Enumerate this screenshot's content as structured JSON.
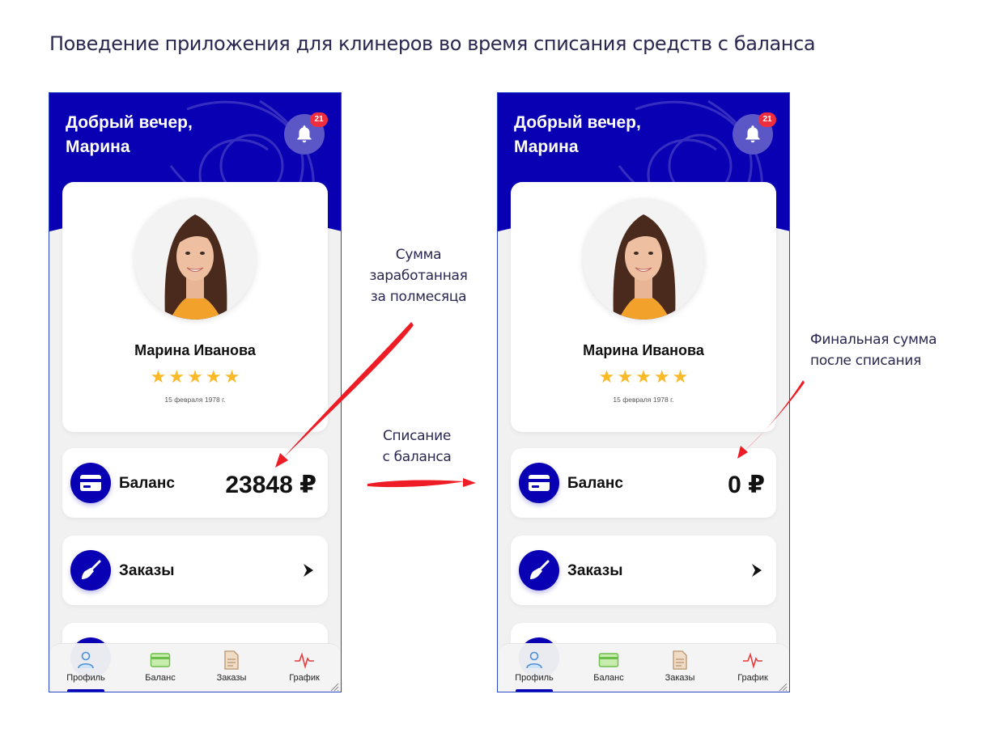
{
  "page": {
    "title": "Поведение приложения для клинеров во время списания средств с баланса"
  },
  "annotations": {
    "earned_line1": "Сумма",
    "earned_line2": "заработанная",
    "earned_line3": "за полмесяца",
    "writeoff_line1": "Списание",
    "writeoff_line2": "с баланса",
    "final_line1": "Финальная сумма",
    "final_line2": "после списания",
    "arrow_color": "#ee1c25"
  },
  "screens": [
    {
      "greeting_line1": "Добрый вечер,",
      "greeting_line2": "Марина",
      "notification_count": "21",
      "profile_name": "Марина Иванова",
      "rating_stars": 5,
      "dob": "15 февраля 1978 г.",
      "balance_label": "Баланс",
      "balance_amount": "23848 ₽",
      "orders_label": "Заказы",
      "tabs": [
        "Профиль",
        "Баланс",
        "Заказы",
        "График"
      ],
      "active_tab": "Профиль"
    },
    {
      "greeting_line1": "Добрый вечер,",
      "greeting_line2": "Марина",
      "notification_count": "21",
      "profile_name": "Марина Иванова",
      "rating_stars": 5,
      "dob": "15 февраля 1978 г.",
      "balance_label": "Баланс",
      "balance_amount": "0 ₽",
      "orders_label": "Заказы",
      "tabs": [
        "Профиль",
        "Баланс",
        "Заказы",
        "График"
      ],
      "active_tab": "Профиль"
    }
  ],
  "colors": {
    "brand": "#0a00b3",
    "badge": "#ee2d3e",
    "star": "#f9b928"
  },
  "icons": {
    "bell": "bell-icon",
    "balance": "credit-card-icon",
    "orders": "broom-icon",
    "chevron": "chevron-right-icon",
    "tab_profile": "user-icon",
    "tab_balance": "wallet-icon",
    "tab_orders": "document-icon",
    "tab_schedule": "pulse-chart-icon"
  }
}
